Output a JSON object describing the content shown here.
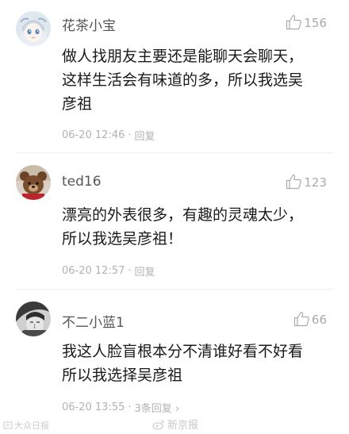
{
  "comments": [
    {
      "username": "花茶小宝",
      "likes": "156",
      "text_lines": [
        "做人找朋友主要还是能聊天会聊天，",
        "这样生活会有味道的多，所以我选吴",
        "彦祖"
      ],
      "date": "06-20 12:46",
      "reply_label": "回复"
    },
    {
      "username": "ted16",
      "likes": "123",
      "text_lines": [
        "漂亮的外表很多，有趣的灵魂太少，",
        "所以我选吴彦祖！"
      ],
      "date": "06-20 12:57",
      "reply_label": "回复"
    },
    {
      "username": "不二小蓝1",
      "likes": "66",
      "text_lines": [
        "我这人脸盲根本分不清谁好看不好看",
        "所以我选择吴彦祖"
      ],
      "date": "06-20 13:55",
      "reply_count": "3条回复",
      "reply_chevron": "›"
    }
  ],
  "watermarks": {
    "left": "大众日报",
    "center": "新京报"
  },
  "icons": {
    "like": "thumbs-up-icon",
    "weibo": "weibo-logo-icon"
  },
  "colors": {
    "meta_gray": "#b2b2b2",
    "username_gray": "#555555",
    "text": "#1a1a1a"
  }
}
